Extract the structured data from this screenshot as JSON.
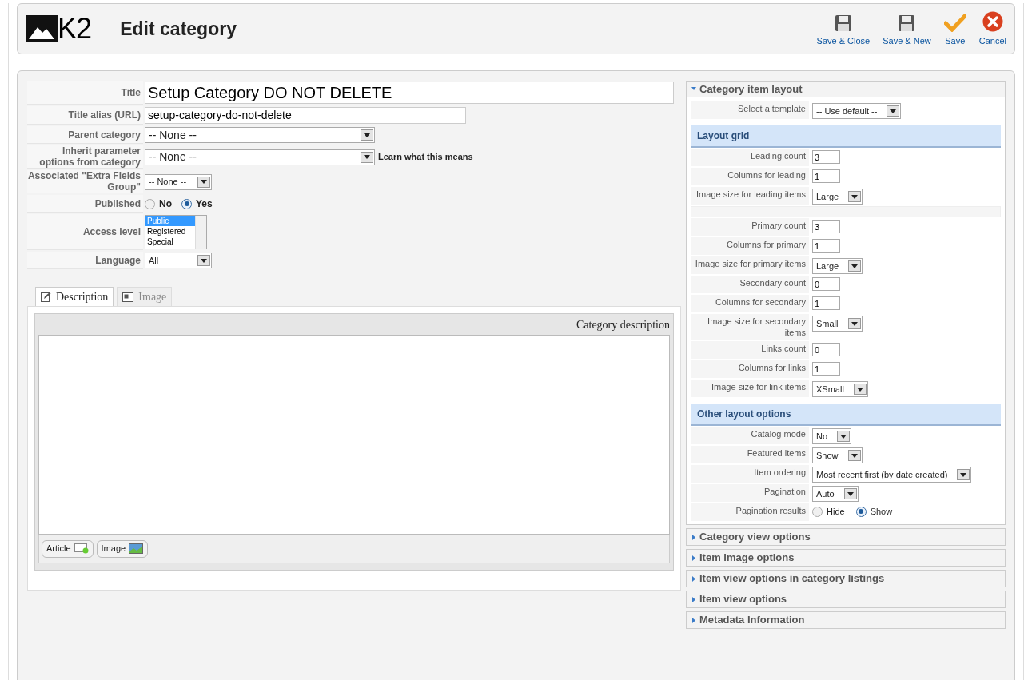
{
  "header": {
    "logo": "K2",
    "title": "Edit category"
  },
  "toolbar": [
    {
      "label": "Save & Close",
      "kind": "save"
    },
    {
      "label": "Save & New",
      "kind": "save"
    },
    {
      "label": "Save",
      "kind": "check"
    },
    {
      "label": "Cancel",
      "kind": "cancel"
    }
  ],
  "form": [
    {
      "label": "Title",
      "kind": "title",
      "value": "Setup Category DO NOT DELETE"
    },
    {
      "label": "Title alias (URL)",
      "kind": "text",
      "value": "setup-category-do-not-delete"
    },
    {
      "label": "Parent category",
      "kind": "select",
      "value": "-- None --"
    },
    {
      "label": "Inherit parameter options from category",
      "kind": "select",
      "value": "-- None --",
      "link": "Learn what this means"
    },
    {
      "label": "Associated \"Extra Fields Group\"",
      "kind": "smallselect",
      "value": "-- None --"
    },
    {
      "label": "Published",
      "kind": "radio",
      "options": [
        {
          "label": "No",
          "selected": false
        },
        {
          "label": "Yes",
          "selected": true
        }
      ]
    },
    {
      "label": "Access level",
      "kind": "listbox",
      "options": [
        {
          "label": "Public",
          "selected": true
        },
        {
          "label": "Registered",
          "selected": false
        },
        {
          "label": "Special",
          "selected": false
        }
      ]
    },
    {
      "label": "Language",
      "kind": "smallselect",
      "value": "All"
    }
  ],
  "editor_tabs": [
    {
      "label": "Description",
      "kind": "edit",
      "selected": true
    },
    {
      "label": "Image",
      "kind": "image",
      "selected": false
    }
  ],
  "editor": {
    "title": "Category description",
    "buttons": [
      {
        "label": "Article",
        "kind": "article"
      },
      {
        "label": "Image",
        "kind": "image"
      }
    ]
  },
  "panels": [
    {
      "title": "Category item layout",
      "expanded": true,
      "rows": [
        {
          "kind": "select",
          "label": "Select a template",
          "value": "-- Use default --"
        },
        {
          "kind": "section",
          "label": "Layout grid"
        },
        {
          "kind": "text",
          "label": "Leading count",
          "value": "3"
        },
        {
          "kind": "text",
          "label": "Columns for leading",
          "value": "1"
        },
        {
          "kind": "select",
          "label": "Image size for leading items",
          "value": "Large"
        },
        {
          "kind": "spacer"
        },
        {
          "kind": "text",
          "label": "Primary count",
          "value": "3"
        },
        {
          "kind": "text",
          "label": "Columns for primary",
          "value": "1"
        },
        {
          "kind": "select",
          "label": "Image size for primary items",
          "value": "Large"
        },
        {
          "kind": "text",
          "label": "Secondary count",
          "value": "0"
        },
        {
          "kind": "text",
          "label": "Columns for secondary",
          "value": "1"
        },
        {
          "kind": "select",
          "label": "Image size for secondary items",
          "value": "Small"
        },
        {
          "kind": "text",
          "label": "Links count",
          "value": "0"
        },
        {
          "kind": "text",
          "label": "Columns for links",
          "value": "1"
        },
        {
          "kind": "select",
          "label": "Image size for link items",
          "value": "XSmall"
        },
        {
          "kind": "section",
          "label": "Other layout options"
        },
        {
          "kind": "select",
          "label": "Catalog mode",
          "value": "No"
        },
        {
          "kind": "select",
          "label": "Featured items",
          "value": "Show"
        },
        {
          "kind": "select",
          "label": "Item ordering",
          "value": "Most recent first (by date created)"
        },
        {
          "kind": "select",
          "label": "Pagination",
          "value": "Auto"
        },
        {
          "kind": "radio",
          "label": "Pagination results",
          "options": [
            {
              "label": "Hide",
              "selected": false
            },
            {
              "label": "Show",
              "selected": true
            }
          ]
        }
      ]
    },
    {
      "title": "Category view options",
      "expanded": false
    },
    {
      "title": "Item image options",
      "expanded": false
    },
    {
      "title": "Item view options in category listings",
      "expanded": false
    },
    {
      "title": "Item view options",
      "expanded": false
    },
    {
      "title": "Metadata Information",
      "expanded": false
    }
  ]
}
